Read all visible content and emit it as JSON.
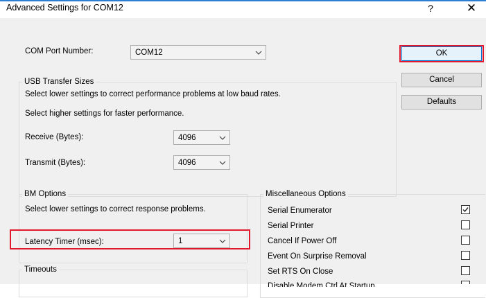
{
  "window": {
    "title": "Advanced Settings for COM12",
    "help_glyph": "?",
    "close_glyph": "✕"
  },
  "com_port": {
    "label": "COM Port Number:",
    "value": "COM12"
  },
  "buttons": {
    "ok": "OK",
    "cancel": "Cancel",
    "defaults": "Defaults"
  },
  "usb": {
    "title": "USB Transfer Sizes",
    "desc_low": "Select lower settings to correct performance problems at low baud rates.",
    "desc_high": "Select higher settings for faster performance.",
    "receive_label": "Receive (Bytes):",
    "receive_value": "4096",
    "transmit_label": "Transmit (Bytes):",
    "transmit_value": "4096"
  },
  "bm": {
    "title": "BM Options",
    "desc": "Select lower settings to correct response problems.",
    "latency_label": "Latency Timer (msec):",
    "latency_value": "1"
  },
  "timeouts": {
    "title": "Timeouts"
  },
  "misc": {
    "title": "Miscellaneous Options",
    "options": [
      {
        "label": "Serial Enumerator",
        "checked": true
      },
      {
        "label": "Serial Printer",
        "checked": false
      },
      {
        "label": "Cancel If Power Off",
        "checked": false
      },
      {
        "label": "Event On Surprise Removal",
        "checked": false
      },
      {
        "label": "Set RTS On Close",
        "checked": false
      },
      {
        "label": "Disable Modem Ctrl At Startup",
        "checked": false
      }
    ]
  },
  "colors": {
    "highlight": "#e0182e",
    "accent": "#2a7fd4"
  }
}
